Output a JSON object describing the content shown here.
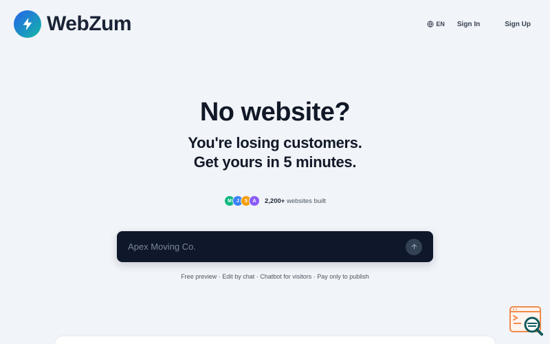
{
  "brand": {
    "name": "WebZum",
    "colors": {
      "gradient_start": "#2563eb",
      "gradient_end": "#14b8a6",
      "text": "#1a2336"
    }
  },
  "nav": {
    "lang_icon": "globe-icon",
    "lang": "EN",
    "sign_in": "Sign In",
    "sign_up": "Sign Up"
  },
  "hero": {
    "headline": "No website?",
    "sub_line1": "You're losing customers.",
    "sub_line2": "Get yours in 5 minutes."
  },
  "social_proof": {
    "avatars": [
      {
        "initial": "M",
        "color": "#10b981"
      },
      {
        "initial": "J",
        "color": "#3b82f6"
      },
      {
        "initial": "S",
        "color": "#f59e0b"
      },
      {
        "initial": "A",
        "color": "#8b5cf6"
      }
    ],
    "count": "2,200+",
    "label": "websites built"
  },
  "prompt": {
    "placeholder": "Apex Moving Co.",
    "send_icon": "arrow-up-icon"
  },
  "features_line": "Free preview · Edit by chat · Chatbot for visitors · Pay only to publish",
  "widget": {
    "icon": "chat-search-icon"
  }
}
